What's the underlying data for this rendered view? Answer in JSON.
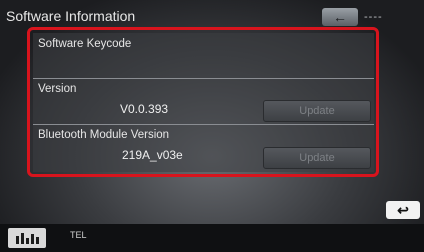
{
  "header": {
    "title": "Software Information",
    "back_icon": "left-arrow",
    "right_text": "----"
  },
  "software": {
    "keycode_label": "Software Keycode",
    "version_label": "Version",
    "version_value": "V0.0.393",
    "version_update_label": "Update",
    "bt_label": "Bluetooth Module Version",
    "bt_value": "219A_v03e",
    "bt_update_label": "Update"
  },
  "footer": {
    "return_icon": "return-arrow",
    "eq_icon": "equalizer-icon",
    "tel_label": "TEL"
  },
  "colors": {
    "highlight": "#d8141d"
  }
}
